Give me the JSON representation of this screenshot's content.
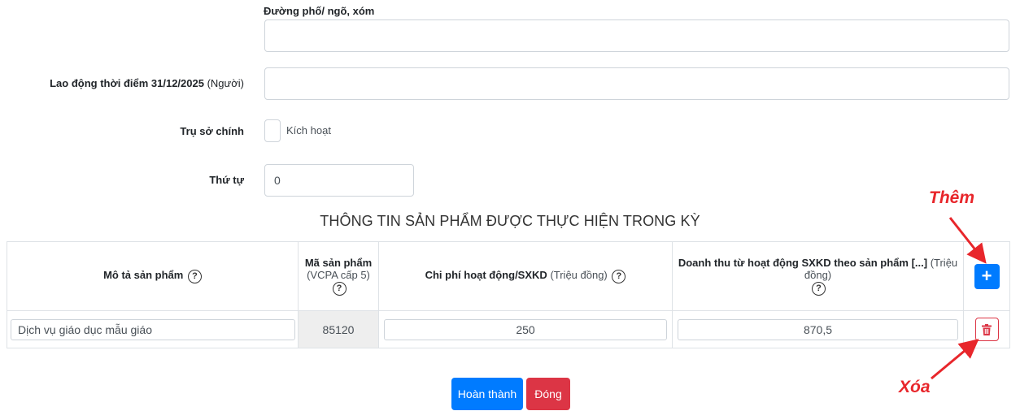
{
  "form": {
    "street_label": "Đường phố/ ngõ, xóm",
    "street_value": "",
    "labor_label": "Lao động thời điểm 31/12/2025",
    "labor_unit": "(Người)",
    "labor_value": "",
    "hq_label": "Trụ sở chính",
    "hq_checkbox_label": "Kích hoạt",
    "order_label": "Thứ tự",
    "order_value": "0"
  },
  "section": {
    "title": "THÔNG TIN SẢN PHẨM ĐƯỢC THỰC HIỆN TRONG KỲ"
  },
  "table": {
    "headers": {
      "description": "Mô tả sản phẩm",
      "code_title": "Mã sản phẩm",
      "code_sub": "(VCPA cấp 5)",
      "cost_title": "Chi phí hoạt động/SXKD",
      "cost_unit": "(Triệu đồng)",
      "revenue_title": "Doanh thu từ hoạt động SXKD theo sản phẩm [...]",
      "revenue_unit": "(Triệu đồng)",
      "help_glyph": "?"
    },
    "rows": [
      {
        "description": "Dịch vụ giáo dục mẫu giáo",
        "code": "85120",
        "cost": "250",
        "revenue": "870,5"
      }
    ],
    "add_glyph": "+"
  },
  "buttons": {
    "complete": "Hoàn thành",
    "close": "Đóng"
  },
  "annotations": {
    "add": "Thêm",
    "delete": "Xóa"
  },
  "colors": {
    "primary": "#007bff",
    "danger": "#dc3545",
    "annotation": "#e8262b"
  }
}
